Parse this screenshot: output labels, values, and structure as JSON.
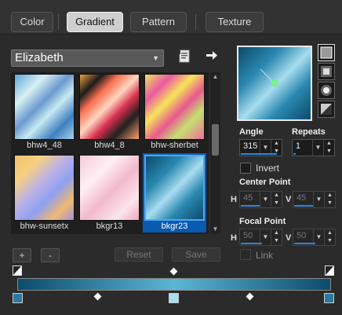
{
  "tabs": [
    "Color",
    "Gradient",
    "Pattern",
    "Texture"
  ],
  "active_tab": "Gradient",
  "preset": {
    "selected": "Elizabeth"
  },
  "icons": {
    "new_doc": "document-icon",
    "export": "arrow-right-icon"
  },
  "gradients": [
    {
      "name": "bhw4_48",
      "css": "linear-gradient(135deg,#5aa6d6 0%,#d8f0f4 25%,#6a9ad0 45%,#c8e8f0 60%,#3f7fc0 80%,#a8d4ec 100%)"
    },
    {
      "name": "bhw4_8",
      "css": "linear-gradient(135deg,#f0a040 0%,#1a1a1a 18%,#ff7050 32%,#ffd7c0 48%,#d93050 62%,#202020 78%,#ffa070 100%)"
    },
    {
      "name": "bhw-sherbet",
      "css": "linear-gradient(135deg,#f4e060 0%,#e95aa0 22%,#f7e45a 40%,#e85890 58%,#c4e070 75%,#f06ea0 100%)"
    },
    {
      "name": "bhw-sunsetx",
      "css": "linear-gradient(135deg,#f4c070 0%,#f7d080 22%,#b8b0e8 45%,#8ea0f0 62%,#f0b870 82%,#a090e0 100%)"
    },
    {
      "name": "bkgr13",
      "css": "linear-gradient(135deg,#f6c8d8 0%,#fff0f4 30%,#f2b8cc 55%,#fbe4ec 80%,#f0a8c0 100%)"
    },
    {
      "name": "bkgr23",
      "css": "linear-gradient(135deg,#0b4a6a 0%,#2a88b0 30%,#a8dcef 52%,#2a88b0 72%,#0b4a6a 100%)"
    }
  ],
  "selected_gradient": "bkgr23",
  "buttons": {
    "add": "+",
    "remove": "-",
    "reset": "Reset",
    "save": "Save"
  },
  "angle": {
    "label": "Angle",
    "value": "315",
    "progress": 0.875
  },
  "repeats": {
    "label": "Repeats",
    "value": "1",
    "progress": 0.05
  },
  "invert": {
    "label": "Invert",
    "checked": false
  },
  "center_point": {
    "label": "Center Point",
    "h_label": "H",
    "h": "45",
    "v_label": "V",
    "v": "45",
    "progress": 0.45
  },
  "focal_point": {
    "label": "Focal Point",
    "h_label": "H",
    "h": "50",
    "v_label": "V",
    "v": "50",
    "progress": 0.5
  },
  "link": {
    "label": "Link",
    "checked": false
  },
  "ramp": {
    "stops_pct": [
      0,
      50,
      100
    ],
    "midpoints_pct": [
      25,
      50,
      75
    ]
  }
}
